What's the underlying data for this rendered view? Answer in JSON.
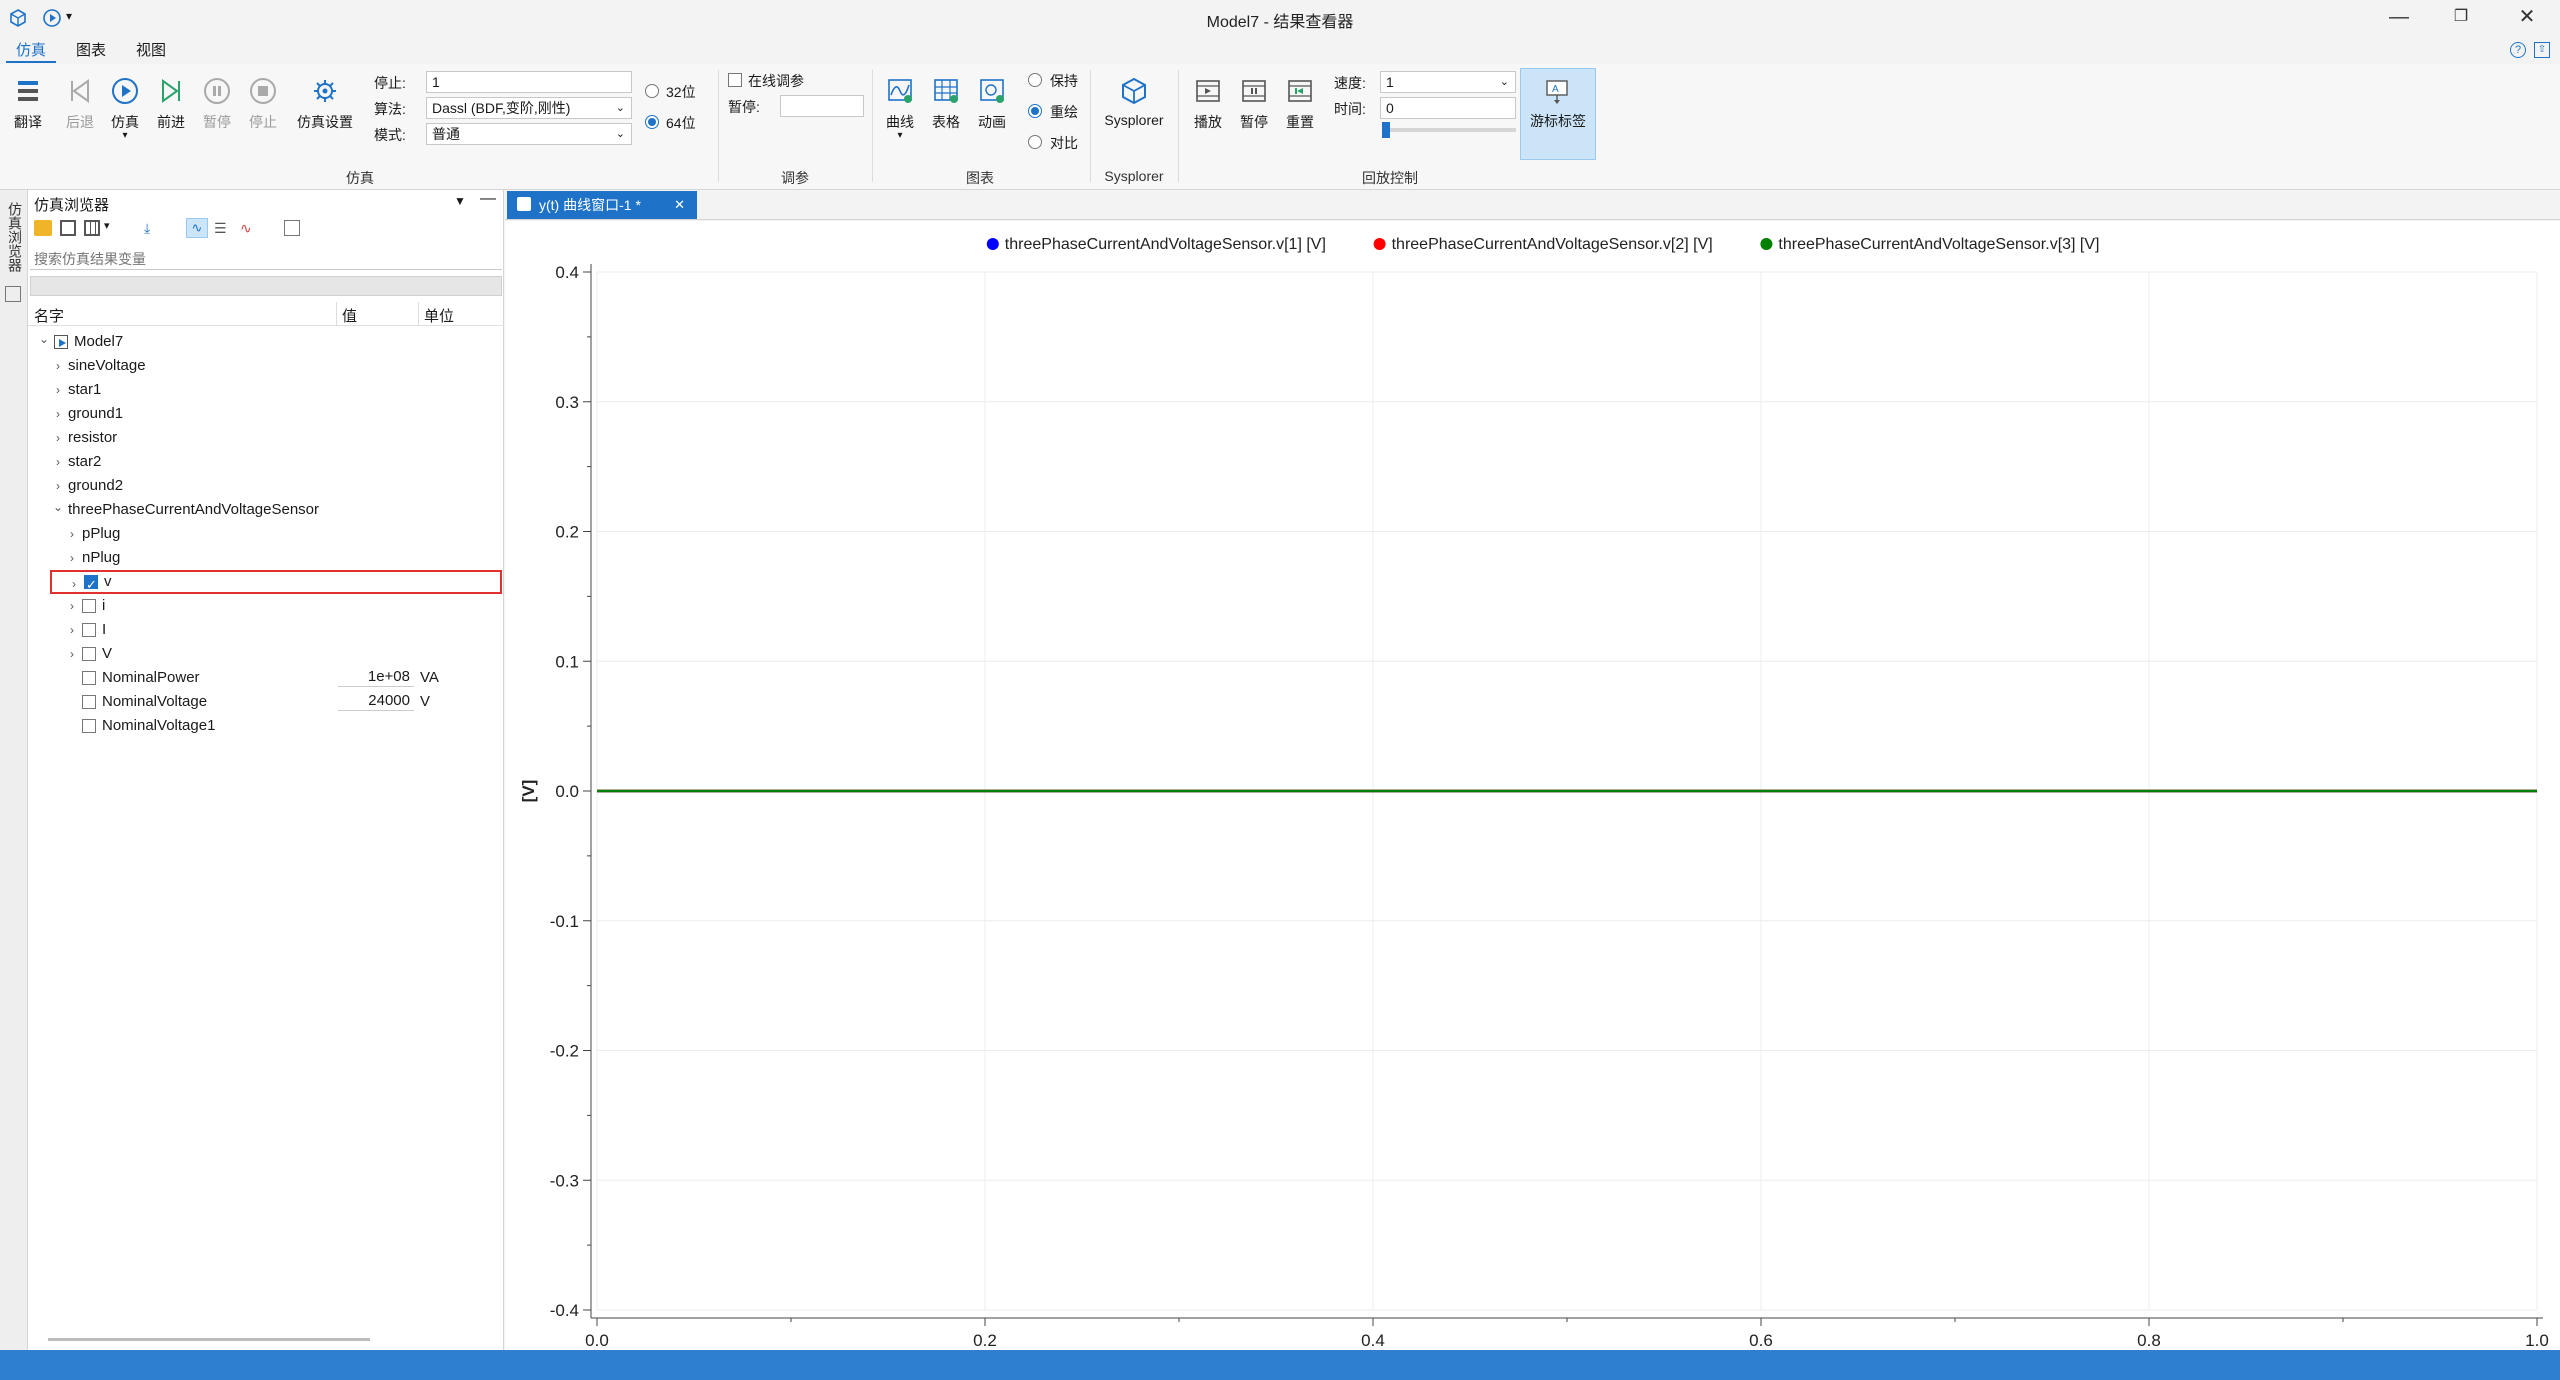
{
  "window": {
    "title": "Model7 - 结果查看器"
  },
  "menu": {
    "tabs": [
      "仿真",
      "图表",
      "视图"
    ]
  },
  "ribbon": {
    "sim_buttons": [
      "翻译",
      "后退",
      "仿真",
      "前进",
      "暂停",
      "停止",
      "仿真设置"
    ],
    "stop_label": "停止:",
    "stop_value": "1",
    "algo_label": "算法:",
    "algo_value": "Dassl (BDF,变阶,刚性)",
    "mode_label": "模式:",
    "mode_value": "普通",
    "bits": [
      "32位",
      "64位"
    ],
    "sim_group": "仿真",
    "online_tune_label": "在线调参",
    "pause_label": "暂停:",
    "tune_group": "调参",
    "chart_buttons": [
      "曲线",
      "表格",
      "动画"
    ],
    "chart_modes": [
      "保持",
      "重绘",
      "对比"
    ],
    "chart_group": "图表",
    "sysplorer_label": "Sysplorer",
    "sysplorer_group": "Sysplorer",
    "playback_buttons": [
      "播放",
      "暂停",
      "重置"
    ],
    "speed_label": "速度:",
    "speed_value": "1",
    "time_label": "时间:",
    "time_value": "0",
    "cursor_tag_label": "游标标签",
    "playback_group": "回放控制"
  },
  "browser": {
    "strip_label": "仿真浏览器",
    "title": "仿真浏览器",
    "search_placeholder": "搜索仿真结果变量",
    "col_name": "名字",
    "col_value": "值",
    "col_unit": "单位",
    "tree": [
      {
        "label": "Model7",
        "level": 0,
        "expanded": true,
        "icon": "model-icon"
      },
      {
        "label": "sineVoltage",
        "level": 1
      },
      {
        "label": "star1",
        "level": 1
      },
      {
        "label": "ground1",
        "level": 1
      },
      {
        "label": "resistor",
        "level": 1
      },
      {
        "label": "star2",
        "level": 1
      },
      {
        "label": "ground2",
        "level": 1
      },
      {
        "label": "threePhaseCurrentAndVoltageSensor",
        "level": 1,
        "expanded": true
      },
      {
        "label": "pPlug",
        "level": 2
      },
      {
        "label": "nPlug",
        "level": 2
      },
      {
        "label": "v",
        "level": 2,
        "checkbox": true,
        "checked": true,
        "selected": true
      },
      {
        "label": "i",
        "level": 2,
        "checkbox": true
      },
      {
        "label": "I",
        "level": 2,
        "checkbox": true
      },
      {
        "label": "V",
        "level": 2,
        "checkbox": true
      },
      {
        "label": "NominalPower",
        "level": 2,
        "checkbox": true,
        "leaf": true,
        "value": "1e+08",
        "unit": "VA"
      },
      {
        "label": "NominalVoltage",
        "level": 2,
        "checkbox": true,
        "leaf": true,
        "value": "24000",
        "unit": "V"
      },
      {
        "label": "NominalVoltage1",
        "level": 2,
        "checkbox": true,
        "leaf": true
      }
    ]
  },
  "chart_tab": {
    "label": "y(t) 曲线窗口-1 *"
  },
  "colors": {
    "accent": "#1e73c8",
    "series1": "#0000ff",
    "series2": "#ff0000",
    "series3": "#008000"
  },
  "chart_data": {
    "type": "line",
    "title": "",
    "xlabel": "",
    "ylabel": "[V]",
    "xlim": [
      0.0,
      1.0
    ],
    "ylim": [
      -0.4,
      0.4
    ],
    "xticks": [
      "0.0",
      "0.2",
      "0.4",
      "0.6",
      "0.8",
      "1.0"
    ],
    "yticks": [
      "0.4",
      "0.3",
      "0.2",
      "0.1",
      "0.0",
      "-0.1",
      "-0.2",
      "-0.3",
      "-0.4"
    ],
    "legend_position": "top-center",
    "grid": true,
    "series": [
      {
        "name": "threePhaseCurrentAndVoltageSensor.v[1] [V]",
        "color": "#0000ff",
        "x": [
          0.0,
          1.0
        ],
        "y": [
          0.0,
          0.0
        ]
      },
      {
        "name": "threePhaseCurrentAndVoltageSensor.v[2] [V]",
        "color": "#ff0000",
        "x": [
          0.0,
          1.0
        ],
        "y": [
          0.0,
          0.0
        ]
      },
      {
        "name": "threePhaseCurrentAndVoltageSensor.v[3] [V]",
        "color": "#008000",
        "x": [
          0.0,
          1.0
        ],
        "y": [
          0.0,
          0.0
        ]
      }
    ]
  }
}
